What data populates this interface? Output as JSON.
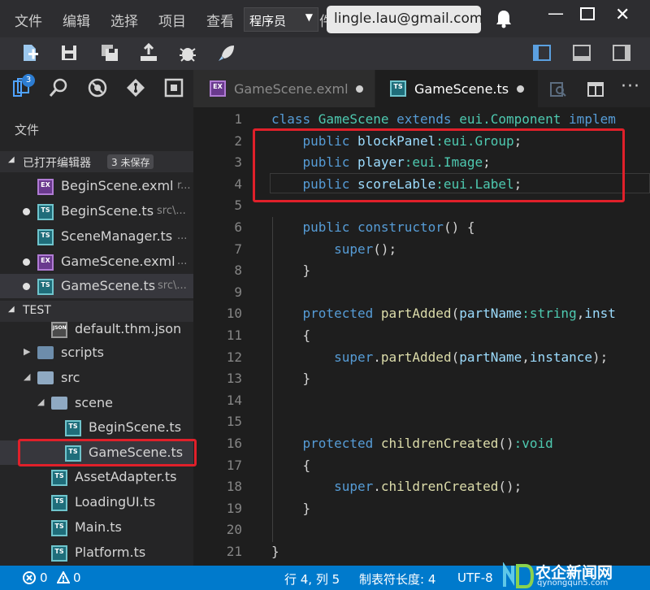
{
  "menubar": {
    "items": [
      "文件",
      "编辑",
      "选择",
      "项目",
      "查看"
    ],
    "role": "程序员",
    "clipped": "件",
    "account_email": "lingle.lau@gmail.com"
  },
  "activity": {
    "explorer_badge": "3"
  },
  "sidebar": {
    "title": "文件",
    "open_editors": {
      "label": "已打开编辑器",
      "unsaved_badge": "3 未保存",
      "files": [
        {
          "name": "BeginScene.exml",
          "path": "r...",
          "icon": "exml-file-icon",
          "modified": false
        },
        {
          "name": "BeginScene.ts",
          "path": "src\\...",
          "icon": "ts-file-icon",
          "modified": true
        },
        {
          "name": "SceneManager.ts",
          "path": "...",
          "icon": "ts-file-icon",
          "modified": false
        },
        {
          "name": "GameScene.exml",
          "path": "...",
          "icon": "exml-file-icon",
          "modified": true
        },
        {
          "name": "GameScene.ts",
          "path": "src\\...",
          "icon": "ts-file-icon",
          "modified": true
        }
      ]
    },
    "project": {
      "label": "TEST",
      "tree": [
        {
          "name": "default.thm.json",
          "icon": "json-file-icon"
        },
        {
          "name": "scripts",
          "icon": "folder-icon"
        },
        {
          "name": "src",
          "icon": "folder-open-icon"
        },
        {
          "name": "scene",
          "icon": "folder-open-icon"
        },
        {
          "name": "BeginScene.ts",
          "icon": "ts-file-icon"
        },
        {
          "name": "GameScene.ts",
          "icon": "ts-file-icon"
        },
        {
          "name": "AssetAdapter.ts",
          "icon": "ts-file-icon"
        },
        {
          "name": "LoadingUI.ts",
          "icon": "ts-file-icon"
        },
        {
          "name": "Main.ts",
          "icon": "ts-file-icon"
        },
        {
          "name": "Platform.ts",
          "icon": "ts-file-icon"
        }
      ]
    }
  },
  "tabs": [
    {
      "label": "GameScene.exml",
      "icon": "exml-file-icon",
      "active": false,
      "modified": true
    },
    {
      "label": "GameScene.ts",
      "icon": "ts-file-icon",
      "active": true,
      "modified": true
    }
  ],
  "editor": {
    "line_numbers": [
      "1",
      "2",
      "3",
      "4",
      "5",
      "6",
      "7",
      "8",
      "9",
      "10",
      "11",
      "12",
      "13",
      "14",
      "15",
      "16",
      "17",
      "18",
      "19",
      "20",
      "21"
    ]
  },
  "statusbar": {
    "errors": "0",
    "warnings": "0",
    "cursor_position": "行 4, 列 5",
    "tab_size": "制表符长度: 4",
    "encoding": "UTF-8"
  },
  "watermark": {
    "text": "农企新闻网",
    "domain": "qynongqun5.com"
  },
  "colors": {
    "highlight_box": "#e0202a",
    "status_bar": "#007acc",
    "keyword": "#569cd6",
    "type": "#4ec9b0"
  }
}
